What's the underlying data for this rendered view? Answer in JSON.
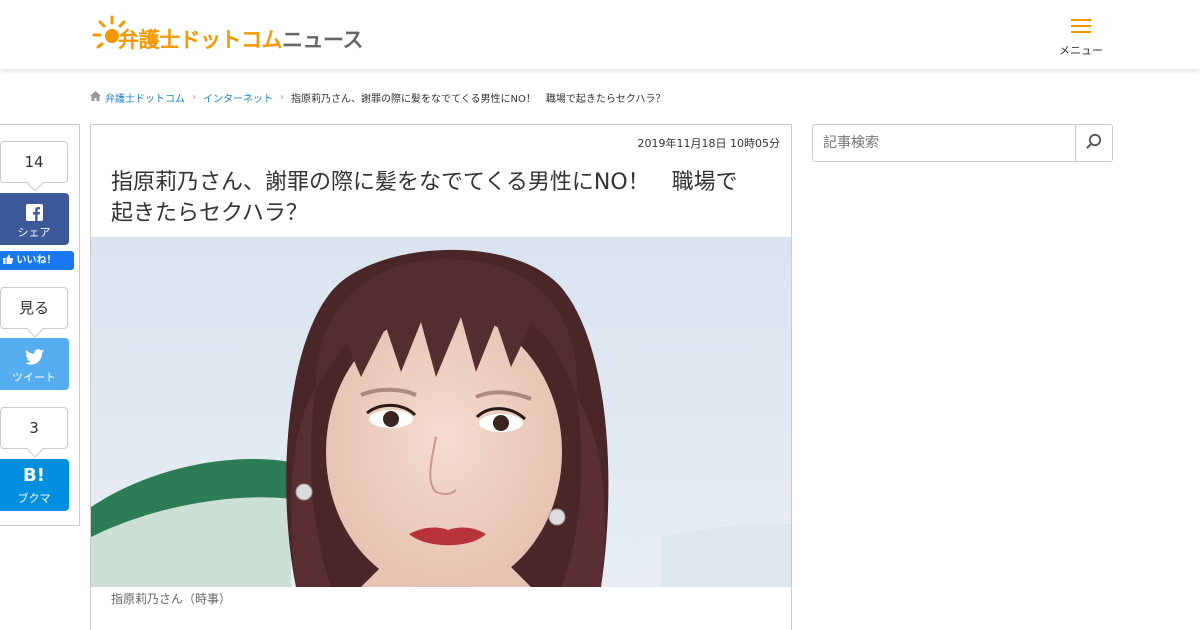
{
  "header": {
    "logo_part1": "弁護士ドットコム",
    "logo_part2": "ニュース",
    "menu_label": "メニュー"
  },
  "breadcrumb": {
    "home": "弁護士ドットコム",
    "category": "インターネット",
    "current": "指原莉乃さん、謝罪の際に髪をなでてくる男性にNO！　職場で起きたらセクハラ？"
  },
  "share": {
    "facebook_count": "14",
    "facebook_label": "シェア",
    "like_label": "いいね！",
    "twitter_count": "見る",
    "twitter_label": "ツイート",
    "hatena_count": "3",
    "hatena_label": "ブクマ",
    "hatena_icon_text": "B!"
  },
  "article": {
    "date": "2019年11月18日 10時05分",
    "title_line1": "指原莉乃さん、謝罪の際に髪をなでてくる男性にNO！　職場で",
    "title_line2": "起きたらセクハラ？",
    "caption": "指原莉乃さん（時事）"
  },
  "search": {
    "placeholder": "記事検索"
  },
  "colors": {
    "brand_orange": "#f39800",
    "link_blue": "#1f82c0",
    "facebook": "#3b5998",
    "twitter": "#55acee",
    "hatena": "#008fde"
  },
  "icons": [
    "home-icon",
    "hamburger-icon",
    "facebook-icon",
    "like-thumb-icon",
    "twitter-icon",
    "hatena-icon",
    "search-icon",
    "chevron-right-icon"
  ]
}
